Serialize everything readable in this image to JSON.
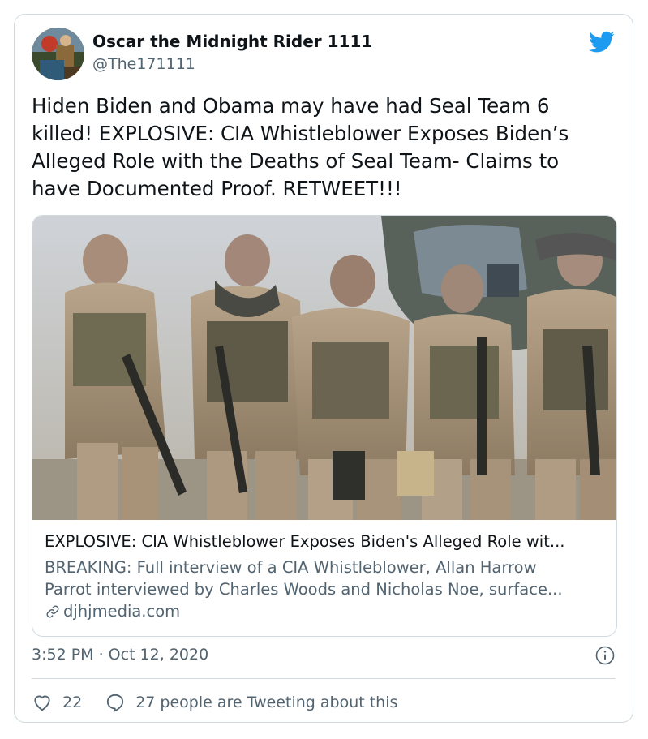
{
  "author": {
    "name": "Oscar the Midnight Rider 1111",
    "handle": "@The171111"
  },
  "tweet": {
    "text": "Hiden Biden and Obama may have had Seal Team 6\nkilled! EXPLOSIVE: CIA Whistleblower Exposes Biden’s\nAlleged Role with the Deaths of Seal Team- Claims to\nhave Documented Proof. RETWEET!!!"
  },
  "link_card": {
    "title": "EXPLOSIVE: CIA Whistleblower Exposes Biden's Alleged Role wit...",
    "description": "BREAKING: Full interview of a CIA Whistleblower, Allan Harrow\nParrot interviewed by Charles Woods and Nicholas Noe, surface...",
    "domain": "djhjmedia.com"
  },
  "meta": {
    "timestamp": "3:52 PM · Oct 12, 2020"
  },
  "actions": {
    "likes": "22",
    "tweeting": "27 people are Tweeting about this"
  },
  "icons": {
    "platform": "twitter-bird-icon",
    "info": "info-icon",
    "link": "link-icon",
    "like": "heart-icon",
    "reply": "speech-bubble-icon"
  },
  "colors": {
    "twitter_blue": "#1d9bf0",
    "secondary_text": "#536471",
    "border": "#cfd9de"
  }
}
